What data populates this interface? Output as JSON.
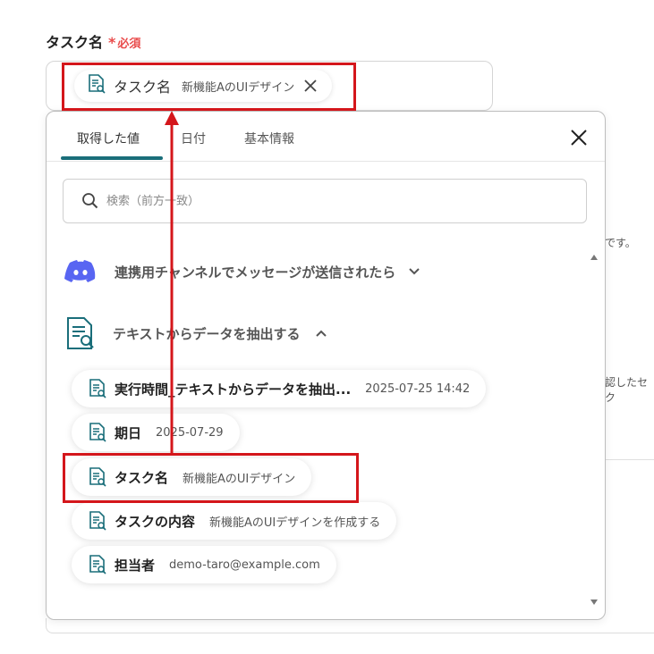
{
  "field": {
    "label": "タスク名",
    "required_star": "*",
    "required_text": "必須",
    "selected_chip": {
      "title": "タスク名",
      "value": "新機能AのUIデザイン"
    }
  },
  "popup": {
    "tabs": [
      {
        "label": "取得した値",
        "active": true
      },
      {
        "label": "日付",
        "active": false
      },
      {
        "label": "基本情報",
        "active": false
      }
    ],
    "search_placeholder": "検索（前方一致）",
    "sections": [
      {
        "label": "連携用チャンネルでメッセージが送信されたら",
        "icon": "discord-icon",
        "expanded": false
      },
      {
        "label": "テキストからデータを抽出する",
        "icon": "document-search-icon",
        "expanded": true
      }
    ],
    "items": [
      {
        "title": "実行時間_テキストからデータを抽出...",
        "value": "2025-07-25 14:42"
      },
      {
        "title": "期日",
        "value": "2025-07-29"
      },
      {
        "title": "タスク名",
        "value": "新機能AのUIデザイン"
      },
      {
        "title": "タスクの内容",
        "value": "新機能AのUIデザインを作成する"
      },
      {
        "title": "担当者",
        "value": "demo-taro@example.com"
      }
    ]
  },
  "background": {
    "text_1": "です。",
    "text_2": "認したセク"
  },
  "colors": {
    "accent": "#1a6e7a",
    "required": "#e94b4b",
    "annotation": "#d4161b",
    "discord": "#5865f2"
  }
}
